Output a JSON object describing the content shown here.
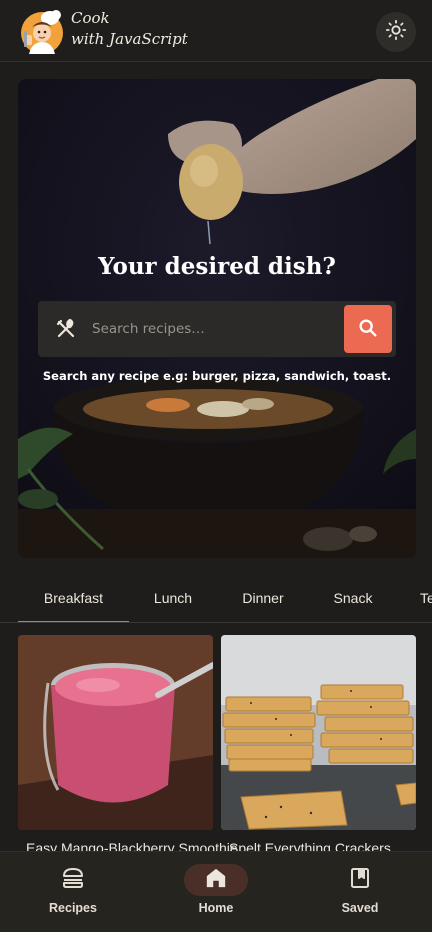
{
  "app": {
    "brand_line1": "Cook",
    "brand_line2": "with JavaScript"
  },
  "header": {
    "theme_toggle_icon": "sun-icon"
  },
  "hero": {
    "title": "Your desired dish?",
    "search": {
      "placeholder": "Search recipes…",
      "value": "",
      "left_icon": "cutlery-icon",
      "submit_icon": "search-icon"
    },
    "hint": "Search any recipe e.g: burger, pizza, sandwich, toast."
  },
  "tabs": [
    {
      "label": "Breakfast",
      "active": true
    },
    {
      "label": "Lunch",
      "active": false
    },
    {
      "label": "Dinner",
      "active": false
    },
    {
      "label": "Snack",
      "active": false
    },
    {
      "label": "Teatime",
      "active": false
    }
  ],
  "recipes": [
    {
      "title": "Easy Mango-Blackberry Smoothie"
    },
    {
      "title": "Spelt Everything Crackers"
    }
  ],
  "bottom_nav": [
    {
      "label": "Recipes",
      "icon": "burger-icon",
      "active": false
    },
    {
      "label": "Home",
      "icon": "home-icon",
      "active": true
    },
    {
      "label": "Saved",
      "icon": "bookmark-icon",
      "active": false
    }
  ],
  "colors": {
    "accent": "#ec6a52",
    "background": "#1e1d1b",
    "surface": "#2b2a28",
    "active_nav_pill": "#4a2f28"
  }
}
